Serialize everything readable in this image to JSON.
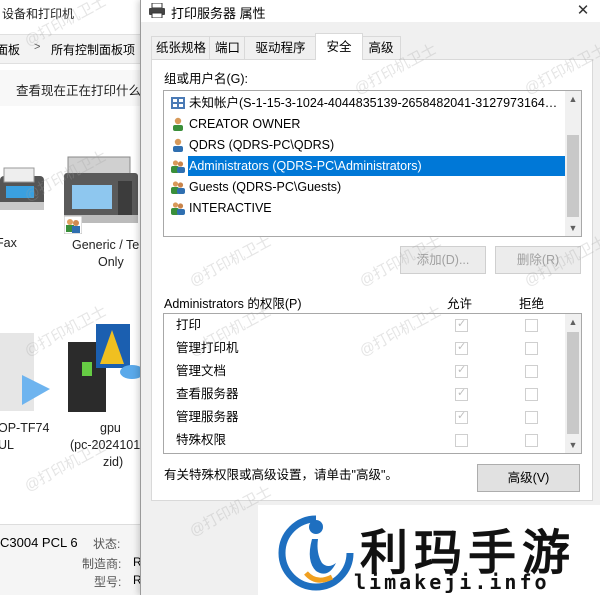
{
  "background_window": {
    "title": "设备和打印机",
    "breadcrumb": [
      "面板",
      "所有控制面板项"
    ],
    "task_link": "查看现在正在打印什么",
    "devices": [
      {
        "label_lines": [
          "Fax"
        ]
      },
      {
        "label_lines": [
          "Generic / Te",
          "Only"
        ]
      },
      {
        "label_lines": [
          "OP-TF74",
          "UL"
        ]
      },
      {
        "label_lines": [
          "gpu",
          "(pc-2024101",
          "zid)"
        ]
      }
    ],
    "status": {
      "model": "C3004 PCL 6",
      "state_label": "状态:",
      "maker_label": "制造商:",
      "model_label": "型号:",
      "maker_value": "R",
      "model_value": "R"
    }
  },
  "dialog": {
    "title": "打印服务器 属性",
    "close_glyph": "✕",
    "tabs": [
      {
        "label": "纸张规格",
        "active": false
      },
      {
        "label": "端口",
        "active": false
      },
      {
        "label": "驱动程序",
        "active": false
      },
      {
        "label": "安全",
        "active": true
      },
      {
        "label": "高级",
        "active": false
      }
    ],
    "users_label": "组或用户名(G):",
    "users": [
      {
        "name": "未知帐户(S-1-15-3-1024-4044835139-2658482041-3127973164…",
        "icon": "unknown-account-icon",
        "selected": false
      },
      {
        "name": "CREATOR OWNER",
        "icon": "user-icon",
        "selected": false
      },
      {
        "name": "QDRS (QDRS-PC\\QDRS)",
        "icon": "user-icon",
        "selected": false
      },
      {
        "name": "Administrators (QDRS-PC\\Administrators)",
        "icon": "group-icon",
        "selected": true
      },
      {
        "name": "Guests (QDRS-PC\\Guests)",
        "icon": "group-icon",
        "selected": false
      },
      {
        "name": "INTERACTIVE",
        "icon": "group-icon",
        "selected": false
      }
    ],
    "add_button": "添加(D)...",
    "remove_button": "删除(R)",
    "perm_title": "Administrators 的权限(P)",
    "allow_header": "允许",
    "deny_header": "拒绝",
    "permissions": [
      {
        "name": "打印",
        "allow": true,
        "deny": false
      },
      {
        "name": "管理打印机",
        "allow": true,
        "deny": false
      },
      {
        "name": "管理文档",
        "allow": true,
        "deny": false
      },
      {
        "name": "查看服务器",
        "allow": true,
        "deny": false
      },
      {
        "name": "管理服务器",
        "allow": true,
        "deny": false
      },
      {
        "name": "特殊权限",
        "allow": false,
        "deny": false
      }
    ],
    "advanced_hint": "有关特殊权限或高级设置，请单击\"高级\"。",
    "advanced_button": "高级(V)"
  },
  "watermark": "@打印机卫士",
  "logo": {
    "chinese": "利玛手游",
    "url": "limakeji.info"
  },
  "colors": {
    "selection": "#0078d7",
    "dialog_bg": "#f0f0f0",
    "logo_blue": "#1e6fc0"
  }
}
